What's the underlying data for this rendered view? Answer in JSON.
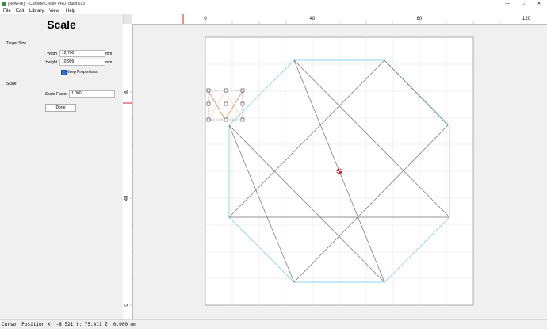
{
  "window": {
    "title": "[NewFile]* - Carbide Create PRO, Build 613",
    "minimize": "—",
    "maximize": "□",
    "close": "✕"
  },
  "menu": [
    "File",
    "Edit",
    "Library",
    "View",
    "Help"
  ],
  "panel": {
    "title": "Scale",
    "target_size_label": "Target Size",
    "width_label": "Width",
    "width_value": "12.700",
    "width_unit": "mm",
    "height_label": "Height",
    "height_value": "10.999",
    "height_unit": "mm",
    "keep_proportions_label": "Keep Proportions",
    "keep_proportions_checked": true,
    "scale_section_label": "Scale",
    "scale_factor_label": "Scale Factor",
    "scale_factor_value": "1.000",
    "done_label": "Done"
  },
  "ruler_top_labels": [
    "0",
    "40",
    "80",
    "120"
  ],
  "ruler_left_labels": [
    "80",
    "40",
    "0"
  ],
  "status": {
    "cursor_position": "Cursor Position X: -8.521 Y: 75.411 Z: 0.000 mm"
  },
  "colors": {
    "stock": "#ffffff",
    "grid": "#e2e2e2",
    "star_lines": "#707070",
    "outline": "#8fd3ee",
    "selected": "#e8864a",
    "origin": "#d62020",
    "ruler_marker": "#d62020"
  },
  "icons": {
    "checkbox": "checkbox-checked-icon",
    "origin": "origin-marker-icon",
    "app": "carbide-create-app-icon"
  }
}
